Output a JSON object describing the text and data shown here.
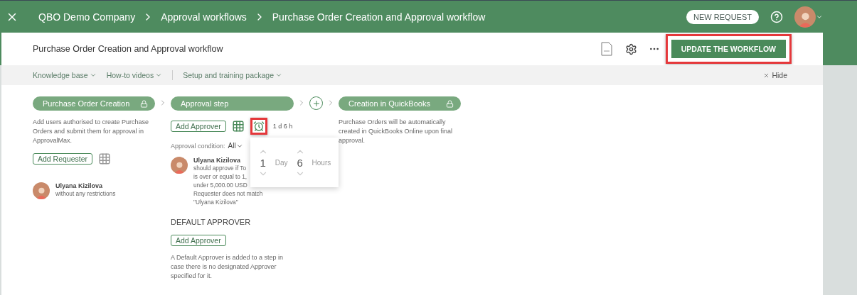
{
  "header": {
    "breadcrumbs": [
      "QBO Demo Company",
      "Approval workflows",
      "Purchase Order Creation and Approval workflow"
    ],
    "new_request": "NEW REQUEST"
  },
  "toolbar": {
    "title": "Purchase Order Creation and Approval workflow",
    "update_button": {
      "label": "UPDATE THE WORKFLOW",
      "highlighted": true
    }
  },
  "help_link_groups": [
    [
      "Knowledge base",
      "How-to videos"
    ],
    [
      "Setup and training package"
    ]
  ],
  "hide": "Hide",
  "steps": [
    {
      "kind": "requester",
      "title": "Purchase Order Creation",
      "locked": true,
      "description": "Add users authorised to create Purchase Orders and submit them for approval in ApprovalMax.",
      "button": "Add Requester",
      "users": [
        {
          "name": "Ulyana Kizilova",
          "lines": [
            "without any restrictions"
          ]
        }
      ]
    },
    {
      "kind": "approval",
      "title": "Approval step",
      "locked": false,
      "button": "Add Approver",
      "deadline": {
        "text": "1 d 6 h",
        "highlighted": true
      },
      "condition_label": "Approval condition:",
      "condition_value": "All",
      "users": [
        {
          "name": "Ulyana Kizilova",
          "lines": [
            "should approve if To",
            "is over or equal to 1,",
            "under 5,000.00 USD",
            "Requester does not match",
            "\"Ulyana Kizilova\""
          ]
        }
      ],
      "default_title": "DEFAULT APPROVER",
      "default_button": "Add Approver",
      "default_note": "A Default Approver is added to a step in case there is no designated Approver specified for it."
    },
    {
      "kind": "auto",
      "title": "Creation in QuickBooks",
      "locked": true,
      "description": "Purchase Orders will be automatically created in QuickBooks Online upon final approval."
    }
  ],
  "deadline_picker": {
    "days": "1",
    "days_unit": "Day",
    "hours": "6",
    "hours_unit": "Hours"
  }
}
